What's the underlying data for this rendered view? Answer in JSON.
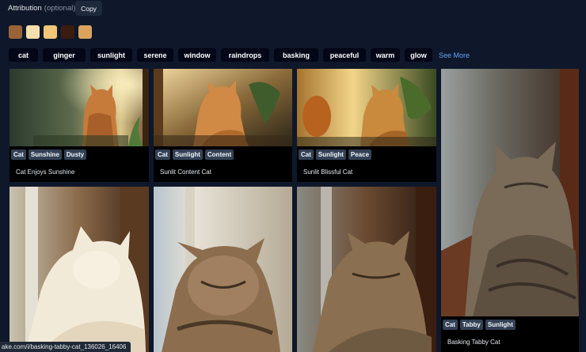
{
  "attribution": {
    "label": "Attribution",
    "optional": "(optional)",
    "colon": ":",
    "copy_label": "Copy"
  },
  "palette": [
    "#9a6337",
    "#f6dfae",
    "#f0c777",
    "#3b1c10",
    "#d9a35e"
  ],
  "tags": [
    "cat",
    "ginger",
    "sunlight",
    "serene",
    "window",
    "raindrops",
    "basking",
    "peaceful",
    "warm",
    "glow"
  ],
  "see_more": "See More",
  "cards": [
    {
      "badges": [
        "Cat",
        "Sunshine",
        "Dusty"
      ],
      "title": "Cat Enjoys Sunshine"
    },
    {
      "badges": [
        "Cat",
        "Sunlight",
        "Content"
      ],
      "title": "Sunlit Content Cat"
    },
    {
      "badges": [
        "Cat",
        "Sunlight",
        "Peace"
      ],
      "title": "Sunlit Blissful Cat"
    },
    {
      "badges": [
        "Cat",
        "Tabby",
        "Sunlight"
      ],
      "title": "Basking Tabby Cat"
    },
    {
      "badges": [],
      "title": ""
    },
    {
      "badges": [],
      "title": ""
    },
    {
      "badges": [],
      "title": ""
    }
  ],
  "status_url": "ake.com/i/basking-tabby-cat_136026_16406"
}
